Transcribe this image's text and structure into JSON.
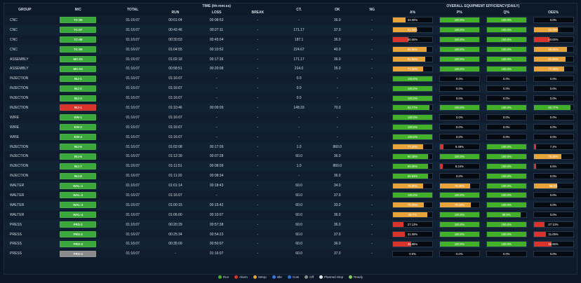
{
  "headers": {
    "group": "GROUP",
    "mc": "M/C",
    "total": "TOTAL",
    "time_title": "TIME (hh:mm:ss)",
    "run": "RUN",
    "loss": "LOSS",
    "break": "BREAK",
    "ct": "CT.",
    "ok": "OK",
    "ng": "NG",
    "oee_title": "OVERALL EQUIPMENT EFFICIENCY(DAILY)",
    "a": "A%",
    "p": "P%",
    "q": "Q%",
    "oee": "OEE%"
  },
  "colors": {
    "run": "#43b02a",
    "alarm": "#d9342b",
    "setup": "#e8a33a",
    "idle": "#3a78d8",
    "cuts": "#2f6fd6",
    "off": "#888888",
    "planned": "#e6e6e6",
    "ready": "#7bd15a"
  },
  "rows": [
    {
      "group": "CNC",
      "mc": "TC-05",
      "mc_color": "#3aa83a",
      "total": "01:16:07",
      "run": "00:01:04",
      "loss": "00:08:53",
      "brk": "-",
      "ct": "-",
      "ok": "36.0",
      "ng": "-",
      "a": {
        "v": "33.00%",
        "p": 33,
        "c": "#e8a33a"
      },
      "p": {
        "v": "100.0%",
        "p": 100,
        "c": "#43b02a"
      },
      "q": {
        "v": "100.0%",
        "p": 100,
        "c": "#43b02a"
      },
      "oee": {
        "v": "0.0%",
        "p": 0,
        "c": "#43b02a"
      }
    },
    {
      "group": "CNC",
      "mc": "TC-07",
      "mc_color": "#3aa83a",
      "total": "01:16:07",
      "run": "00:42:46",
      "loss": "00:27:11",
      "brk": "-",
      "ct": "171.17",
      "ok": "37.0",
      "ng": "-",
      "a": {
        "v": "61.09%",
        "p": 61,
        "c": "#e8a33a"
      },
      "p": {
        "v": "100.0%",
        "p": 100,
        "c": "#43b02a"
      },
      "q": {
        "v": "100.0%",
        "p": 100,
        "c": "#43b02a"
      },
      "oee": {
        "v": "61.09%",
        "p": 61,
        "c": "#e8a33a"
      }
    },
    {
      "group": "CNC",
      "mc": "TC-08",
      "mc_color": "#3aa83a",
      "total": "01:16:07",
      "run": "00:30:53",
      "loss": "00:45:04",
      "brk": "-",
      "ct": "187.1",
      "ok": "36.0",
      "ng": "-",
      "a": {
        "v": "40.00%",
        "p": 40,
        "c": "#d9342b"
      },
      "p": {
        "v": "100.0%",
        "p": 100,
        "c": "#43b02a"
      },
      "q": {
        "v": "100.0%",
        "p": 100,
        "c": "#43b02a"
      },
      "oee": {
        "v": "40.00%",
        "p": 40,
        "c": "#d9342b"
      }
    },
    {
      "group": "CNC",
      "mc": "TC-09",
      "mc_color": "#3aa83a",
      "total": "01:16:07",
      "run": "01:04:55",
      "loss": "00:10:52",
      "brk": "-",
      "ct": "224.67",
      "ok": "40.0",
      "ng": "-",
      "a": {
        "v": "85.30%",
        "p": 85,
        "c": "#e8a33a"
      },
      "p": {
        "v": "100.0%",
        "p": 100,
        "c": "#43b02a"
      },
      "q": {
        "v": "100.0%",
        "p": 100,
        "c": "#43b02a"
      },
      "oee": {
        "v": "85.30%",
        "p": 85,
        "c": "#e8a33a"
      }
    },
    {
      "group": "ASSEMBLY",
      "mc": "MC-01",
      "mc_color": "#3aa83a",
      "total": "01:16:07",
      "run": "01:02:18",
      "loss": "00:17:36",
      "brk": "-",
      "ct": "171.17",
      "ok": "36.0",
      "ng": "-",
      "a": {
        "v": "81.80%",
        "p": 82,
        "c": "#e8a33a"
      },
      "p": {
        "v": "100.0%",
        "p": 100,
        "c": "#43b02a"
      },
      "q": {
        "v": "100.0%",
        "p": 100,
        "c": "#43b02a"
      },
      "oee": {
        "v": "81.80%",
        "p": 82,
        "c": "#e8a33a"
      }
    },
    {
      "group": "ASSEMBLY",
      "mc": "MC-02",
      "mc_color": "#3aa83a",
      "total": "01:16:07",
      "run": "00:58:51",
      "loss": "00:20:08",
      "brk": "-",
      "ct": "224.0",
      "ok": "35.0",
      "ng": "-",
      "a": {
        "v": "77.30%",
        "p": 77,
        "c": "#e8a33a"
      },
      "p": {
        "v": "100.0%",
        "p": 100,
        "c": "#43b02a"
      },
      "q": {
        "v": "100.0%",
        "p": 100,
        "c": "#43b02a"
      },
      "oee": {
        "v": "77.30%",
        "p": 77,
        "c": "#e8a33a"
      }
    },
    {
      "group": "INJECTION",
      "mc": "INJ-1",
      "mc_color": "#3aa83a",
      "total": "01:16:07",
      "run": "01:16:07",
      "loss": "-",
      "brk": "-",
      "ct": "0.0",
      "ok": "-",
      "ng": "-",
      "a": {
        "v": "100.0%",
        "p": 100,
        "c": "#43b02a"
      },
      "p": {
        "v": "0.0%",
        "p": 0,
        "c": "#43b02a"
      },
      "q": {
        "v": "0.0%",
        "p": 0,
        "c": "#43b02a"
      },
      "oee": {
        "v": "0.0%",
        "p": 0,
        "c": "#43b02a"
      }
    },
    {
      "group": "INJECTION",
      "mc": "INJ-2",
      "mc_color": "#3aa83a",
      "total": "01:16:07",
      "run": "01:16:07",
      "loss": "-",
      "brk": "-",
      "ct": "0.0",
      "ok": "-",
      "ng": "-",
      "a": {
        "v": "100.0%",
        "p": 100,
        "c": "#43b02a"
      },
      "p": {
        "v": "0.0%",
        "p": 0,
        "c": "#43b02a"
      },
      "q": {
        "v": "0.0%",
        "p": 0,
        "c": "#43b02a"
      },
      "oee": {
        "v": "0.0%",
        "p": 0,
        "c": "#43b02a"
      }
    },
    {
      "group": "INJECTION",
      "mc": "INJ-3",
      "mc_color": "#3aa83a",
      "total": "01:16:07",
      "run": "01:16:07",
      "loss": "-",
      "brk": "-",
      "ct": "0.0",
      "ok": "-",
      "ng": "-",
      "a": {
        "v": "100.0%",
        "p": 100,
        "c": "#43b02a"
      },
      "p": {
        "v": "0.0%",
        "p": 0,
        "c": "#43b02a"
      },
      "q": {
        "v": "0.0%",
        "p": 0,
        "c": "#43b02a"
      },
      "oee": {
        "v": "0.0%",
        "p": 0,
        "c": "#43b02a"
      }
    },
    {
      "group": "INJECTION",
      "mc": "INJ-1",
      "mc_color": "#d9342b",
      "total": "01:16:07",
      "run": "01:10:46",
      "loss": "00:09:09",
      "brk": "-",
      "ct": "148.33",
      "ok": "70.0",
      "ng": "-",
      "a": {
        "v": "92.77%",
        "p": 93,
        "c": "#43b02a"
      },
      "p": {
        "v": "100.0%",
        "p": 100,
        "c": "#43b02a"
      },
      "q": {
        "v": "100.0%",
        "p": 100,
        "c": "#43b02a"
      },
      "oee": {
        "v": "92.77%",
        "p": 93,
        "c": "#43b02a"
      }
    },
    {
      "group": "WIRE",
      "mc": "EW-1",
      "mc_color": "#3aa83a",
      "total": "01:16:07",
      "run": "01:16:07",
      "loss": "-",
      "brk": "-",
      "ct": "-",
      "ok": "-",
      "ng": "-",
      "a": {
        "v": "100.0%",
        "p": 100,
        "c": "#43b02a"
      },
      "p": {
        "v": "0.0%",
        "p": 0,
        "c": "#43b02a"
      },
      "q": {
        "v": "0.0%",
        "p": 0,
        "c": "#43b02a"
      },
      "oee": {
        "v": "0.0%",
        "p": 0,
        "c": "#43b02a"
      }
    },
    {
      "group": "WIRE",
      "mc": "EW-2",
      "mc_color": "#3aa83a",
      "total": "01:16:07",
      "run": "01:16:07",
      "loss": "-",
      "brk": "-",
      "ct": "-",
      "ok": "-",
      "ng": "-",
      "a": {
        "v": "100.0%",
        "p": 100,
        "c": "#43b02a"
      },
      "p": {
        "v": "0.0%",
        "p": 0,
        "c": "#43b02a"
      },
      "q": {
        "v": "0.0%",
        "p": 0,
        "c": "#43b02a"
      },
      "oee": {
        "v": "0.0%",
        "p": 0,
        "c": "#43b02a"
      }
    },
    {
      "group": "WIRE",
      "mc": "EW-3",
      "mc_color": "#3aa83a",
      "total": "01:16:07",
      "run": "01:16:07",
      "loss": "-",
      "brk": "-",
      "ct": "-",
      "ok": "-",
      "ng": "-",
      "a": {
        "v": "100.0%",
        "p": 100,
        "c": "#43b02a"
      },
      "p": {
        "v": "0.0%",
        "p": 0,
        "c": "#43b02a"
      },
      "q": {
        "v": "0.0%",
        "p": 0,
        "c": "#43b02a"
      },
      "oee": {
        "v": "0.0%",
        "p": 0,
        "c": "#43b02a"
      }
    },
    {
      "group": "INJECTION",
      "mc": "INJ-5",
      "mc_color": "#3aa83a",
      "total": "01:16:07",
      "run": "01:02:08",
      "loss": "00:17:09",
      "brk": "-",
      "ct": "1.0",
      "ok": "860.0",
      "ng": "-",
      "a": {
        "v": "77.42%",
        "p": 77,
        "c": "#e8a33a"
      },
      "p": {
        "v": "9.38%",
        "p": 9,
        "c": "#d9342b"
      },
      "q": {
        "v": "100.0%",
        "p": 100,
        "c": "#43b02a"
      },
      "oee": {
        "v": "7.2%",
        "p": 7,
        "c": "#d9342b"
      }
    },
    {
      "group": "INJECTION",
      "mc": "INJ-6",
      "mc_color": "#3aa83a",
      "total": "01:16:07",
      "run": "01:12:39",
      "loss": "00:07:28",
      "brk": "-",
      "ct": "60.0",
      "ok": "36.0",
      "ng": "-",
      "a": {
        "v": "90.30%",
        "p": 90,
        "c": "#43b02a"
      },
      "p": {
        "v": "100.0%",
        "p": 100,
        "c": "#43b02a"
      },
      "q": {
        "v": "100.0%",
        "p": 100,
        "c": "#43b02a"
      },
      "oee": {
        "v": "70.30%",
        "p": 70,
        "c": "#e8a33a"
      }
    },
    {
      "group": "INJECTION",
      "mc": "INJ-7",
      "mc_color": "#3aa83a",
      "total": "01:16:07",
      "run": "01:11:51",
      "loss": "00:08:09",
      "brk": "-",
      "ct": "1.0",
      "ok": "860.0",
      "ng": "-",
      "a": {
        "v": "89.00%",
        "p": 89,
        "c": "#43b02a"
      },
      "p": {
        "v": "8.24%",
        "p": 8,
        "c": "#d9342b"
      },
      "q": {
        "v": "100.0%",
        "p": 100,
        "c": "#43b02a"
      },
      "oee": {
        "v": "6.5%",
        "p": 7,
        "c": "#d9342b"
      }
    },
    {
      "group": "INJECTION",
      "mc": "INJ-8",
      "mc_color": "#3aa83a",
      "total": "01:16:07",
      "run": "01:11:20",
      "loss": "00:08:34",
      "brk": "-",
      "ct": "-",
      "ok": "36.0",
      "ng": "-",
      "a": {
        "v": "88.64%",
        "p": 89,
        "c": "#43b02a"
      },
      "p": {
        "v": "0.0%",
        "p": 0,
        "c": "#43b02a"
      },
      "q": {
        "v": "100.0%",
        "p": 100,
        "c": "#43b02a"
      },
      "oee": {
        "v": "0.0%",
        "p": 0,
        "c": "#43b02a"
      }
    },
    {
      "group": "WALTER",
      "mc": "WAL-1",
      "mc_color": "#3aa83a",
      "total": "01:16:07",
      "run": "01:01:14",
      "loss": "00:18:43",
      "brk": "-",
      "ct": "60.0",
      "ok": "34.0",
      "ng": "-",
      "a": {
        "v": "76.00%",
        "p": 76,
        "c": "#e8a33a"
      },
      "p": {
        "v": "78.00%",
        "p": 78,
        "c": "#e8a33a"
      },
      "q": {
        "v": "100.0%",
        "p": 100,
        "c": "#43b02a"
      },
      "oee": {
        "v": "59.0%",
        "p": 59,
        "c": "#e8a33a"
      }
    },
    {
      "group": "WALTER",
      "mc": "WAL-2",
      "mc_color": "#3aa83a",
      "total": "01:16:07",
      "run": "01:16:07",
      "loss": "-",
      "brk": "-",
      "ct": "60.0",
      "ok": "37.0",
      "ng": "-",
      "a": {
        "v": "100.0%",
        "p": 100,
        "c": "#43b02a"
      },
      "p": {
        "v": "100.0%",
        "p": 100,
        "c": "#43b02a"
      },
      "q": {
        "v": "100.0%",
        "p": 100,
        "c": "#43b02a"
      },
      "oee": {
        "v": "0.0%",
        "p": 0,
        "c": "#43b02a"
      }
    },
    {
      "group": "WALTER",
      "mc": "WAL-3",
      "mc_color": "#3aa83a",
      "total": "01:16:07",
      "run": "01:00:15",
      "loss": "00:15:42",
      "brk": "-",
      "ct": "60.0",
      "ok": "33.0",
      "ng": "-",
      "a": {
        "v": "79.00%",
        "p": 79,
        "c": "#e8a33a"
      },
      "p": {
        "v": "79.00%",
        "p": 79,
        "c": "#e8a33a"
      },
      "q": {
        "v": "100.0%",
        "p": 100,
        "c": "#43b02a"
      },
      "oee": {
        "v": "0.0%",
        "p": 0,
        "c": "#43b02a"
      }
    },
    {
      "group": "WALTER",
      "mc": "WAL-4",
      "mc_color": "#3aa83a",
      "total": "01:16:07",
      "run": "01:06:00",
      "loss": "00:10:07",
      "brk": "-",
      "ct": "60.0",
      "ok": "36.0",
      "ng": "-",
      "a": {
        "v": "86.7%",
        "p": 87,
        "c": "#e8a33a"
      },
      "p": {
        "v": "100.0%",
        "p": 100,
        "c": "#43b02a"
      },
      "q": {
        "v": "86.9%",
        "p": 87,
        "c": "#43b02a"
      },
      "oee": {
        "v": "0.0%",
        "p": 0,
        "c": "#43b02a"
      }
    },
    {
      "group": "PRESS",
      "mc": "PRS-1",
      "mc_color": "#3aa83a",
      "total": "01:16:07",
      "run": "00:20:29",
      "loss": "00:57:38",
      "brk": "-",
      "ct": "60.0",
      "ok": "36.0",
      "ng": "-",
      "a": {
        "v": "27.13%",
        "p": 27,
        "c": "#d9342b"
      },
      "p": {
        "v": "100.0%",
        "p": 100,
        "c": "#43b02a"
      },
      "q": {
        "v": "100.0%",
        "p": 100,
        "c": "#43b02a"
      },
      "oee": {
        "v": "27.13%",
        "p": 27,
        "c": "#d9342b"
      }
    },
    {
      "group": "PRESS",
      "mc": "PRS-2",
      "mc_color": "#3aa83a",
      "total": "01:16:07",
      "run": "00:25:34",
      "loss": "00:54:23",
      "brk": "-",
      "ct": "60.0",
      "ok": "37.0",
      "ng": "-",
      "a": {
        "v": "31.09%",
        "p": 31,
        "c": "#d9342b"
      },
      "p": {
        "v": "100.0%",
        "p": 100,
        "c": "#43b02a"
      },
      "q": {
        "v": "100.0%",
        "p": 100,
        "c": "#43b02a"
      },
      "oee": {
        "v": "31.09%",
        "p": 31,
        "c": "#d9342b"
      }
    },
    {
      "group": "PRESS",
      "mc": "PRS-3",
      "mc_color": "#3aa83a",
      "total": "01:16:07",
      "run": "00:35:09",
      "loss": "00:50:07",
      "brk": "-",
      "ct": "60.0",
      "ok": "36.0",
      "ng": "-",
      "a": {
        "v": "45.65%",
        "p": 46,
        "c": "#d9342b"
      },
      "p": {
        "v": "100.0%",
        "p": 100,
        "c": "#43b02a"
      },
      "q": {
        "v": "100.0%",
        "p": 100,
        "c": "#43b02a"
      },
      "oee": {
        "v": "45.65%",
        "p": 46,
        "c": "#d9342b"
      }
    },
    {
      "group": "PRESS",
      "mc": "PRS-4",
      "mc_color": "#8a8a8a",
      "total": "01:16:07",
      "run": "-",
      "loss": "01:16:07",
      "brk": "-",
      "ct": "60.0",
      "ok": "37.0",
      "ng": "-",
      "a": {
        "v": "0.0%",
        "p": 0,
        "c": "#43b02a"
      },
      "p": {
        "v": "0.0%",
        "p": 0,
        "c": "#43b02a"
      },
      "q": {
        "v": "0.0%",
        "p": 0,
        "c": "#43b02a"
      },
      "oee": {
        "v": "0.0%",
        "p": 0,
        "c": "#43b02a"
      }
    }
  ],
  "legend": [
    {
      "label": "Run",
      "color": "#43b02a"
    },
    {
      "label": "Alarm",
      "color": "#d9342b"
    },
    {
      "label": "Setup",
      "color": "#e8a33a"
    },
    {
      "label": "Idle",
      "color": "#3a78d8"
    },
    {
      "label": "Cuts",
      "color": "#2f6fd6"
    },
    {
      "label": "Off",
      "color": "#888888"
    },
    {
      "label": "Planned Stop",
      "color": "#e6e6e6"
    },
    {
      "label": "Ready",
      "color": "#7bd15a"
    }
  ]
}
